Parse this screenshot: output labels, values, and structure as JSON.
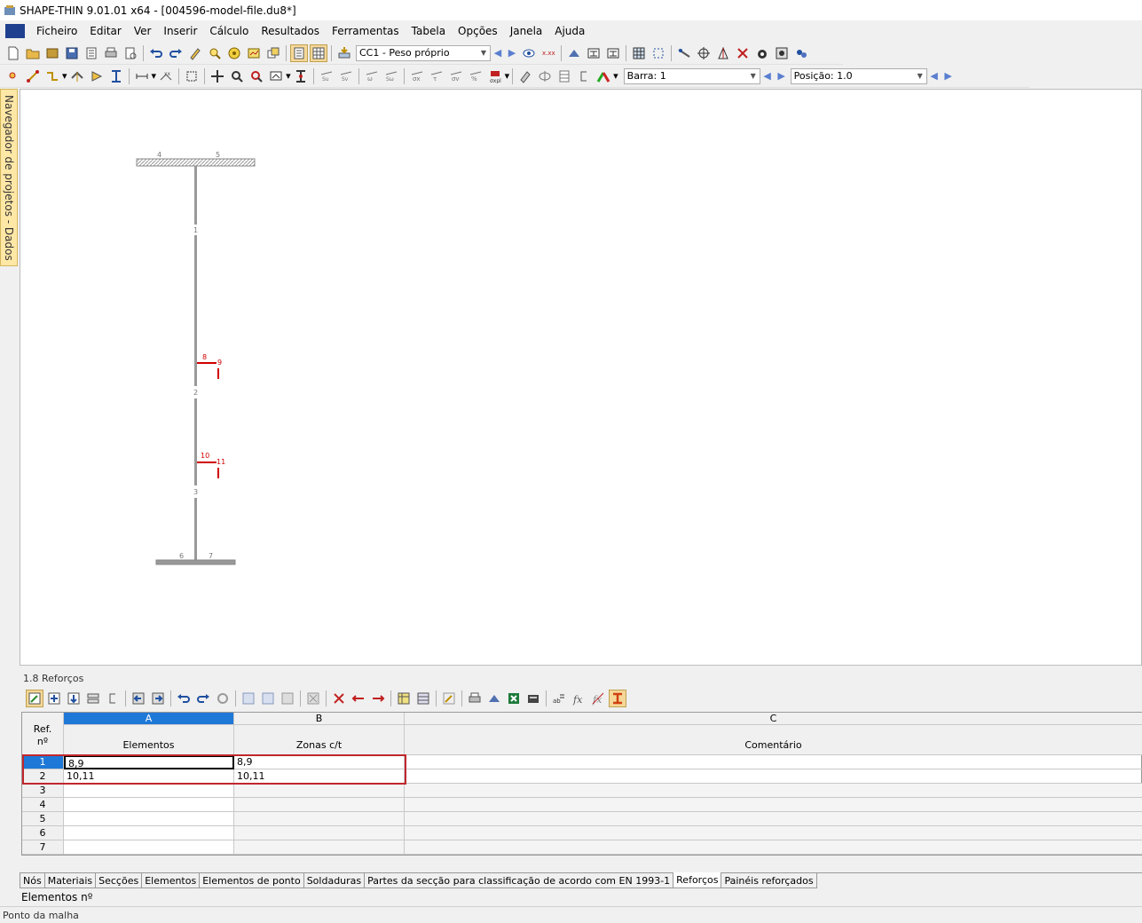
{
  "window": {
    "title": "SHAPE-THIN 9.01.01 x64 - [004596-model-file.du8*]"
  },
  "menu": {
    "items": [
      "Ficheiro",
      "Editar",
      "Ver",
      "Inserir",
      "Cálculo",
      "Resultados",
      "Ferramentas",
      "Tabela",
      "Opções",
      "Janela",
      "Ajuda"
    ]
  },
  "toolbar": {
    "load_case": "CC1 - Peso próprio",
    "bar_label": "Barra: 1",
    "position_label": "Posição: 1.0"
  },
  "sidebar": {
    "navigator_label": "Navegador de projetos - Dados"
  },
  "drawing": {
    "node_labels": [
      "4",
      "5",
      "1",
      "2",
      "3",
      "6",
      "7"
    ],
    "red_labels": [
      "8",
      "9",
      "10",
      "11"
    ]
  },
  "panel": {
    "title": "1.8 Reforços",
    "columns": {
      "ref_header": "Ref.\nnº",
      "col_a_letter": "A",
      "col_a_name": "Elementos",
      "col_b_letter": "B",
      "col_b_name": "Zonas c/t",
      "col_c_letter": "C",
      "col_c_name": "Comentário"
    },
    "rows": [
      {
        "no": "1",
        "elements": "8,9",
        "zones": "8,9",
        "comment": ""
      },
      {
        "no": "2",
        "elements": "10,11",
        "zones": "10,11",
        "comment": ""
      },
      {
        "no": "3",
        "elements": "",
        "zones": "",
        "comment": ""
      },
      {
        "no": "4",
        "elements": "",
        "zones": "",
        "comment": ""
      },
      {
        "no": "5",
        "elements": "",
        "zones": "",
        "comment": ""
      },
      {
        "no": "6",
        "elements": "",
        "zones": "",
        "comment": ""
      },
      {
        "no": "7",
        "elements": "",
        "zones": "",
        "comment": ""
      }
    ]
  },
  "tabs": [
    "Nós",
    "Materiais",
    "Secções",
    "Elementos",
    "Elementos de ponto",
    "Soldaduras",
    "Partes da secção para classificação de acordo com EN 1993-1",
    "Reforços",
    "Painéis reforçados"
  ],
  "active_tab": "Reforços",
  "description_line": "Elementos nº",
  "status": "Ponto da malha",
  "colors": {
    "highlight_red": "#c0272d",
    "selected_blue": "#1e78d7",
    "accent_red": "#d00000"
  }
}
